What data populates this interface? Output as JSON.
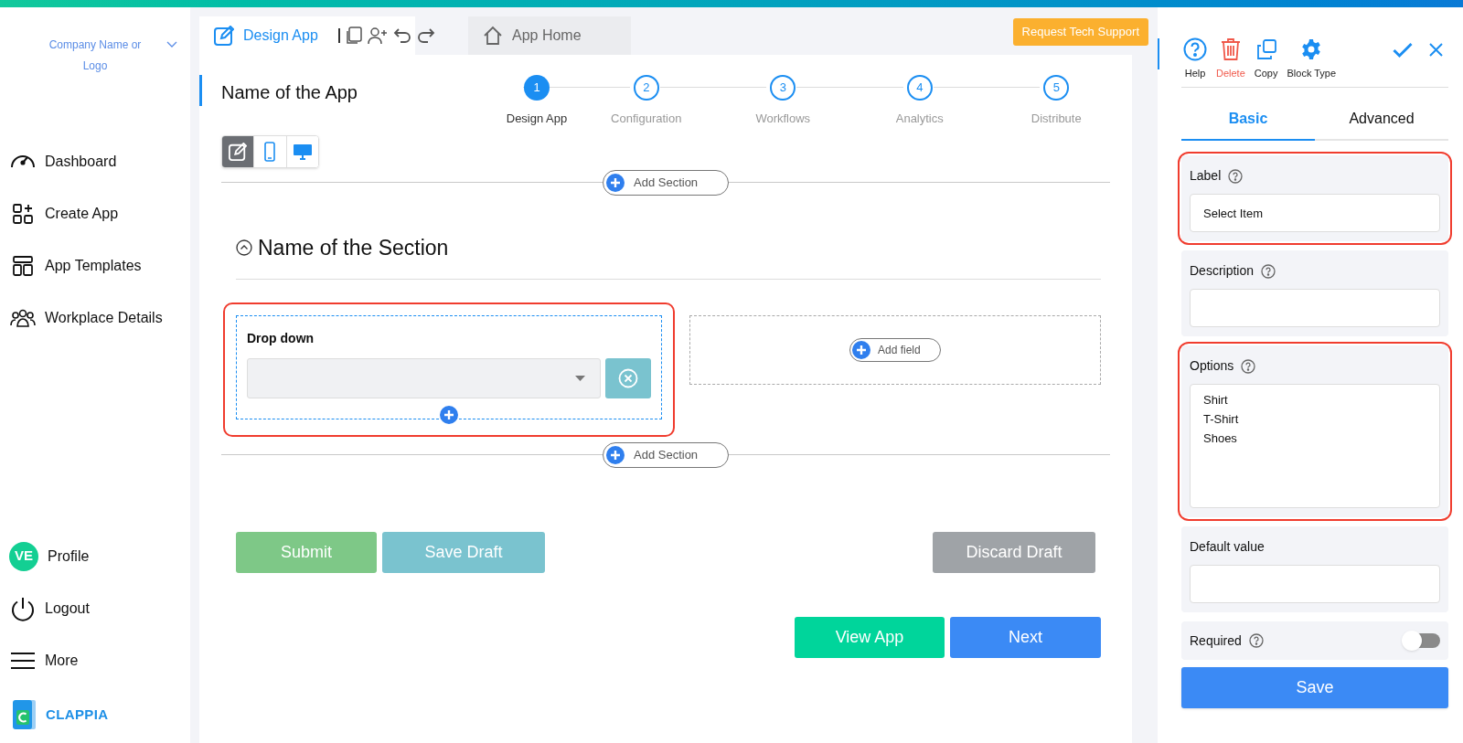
{
  "sidebar": {
    "company": "Company Name or Logo",
    "nav": [
      {
        "label": "Dashboard",
        "kind": "gauge"
      },
      {
        "label": "Create App",
        "kind": "create"
      },
      {
        "label": "App Templates",
        "kind": "templates"
      },
      {
        "label": "Workplace Details",
        "kind": "people"
      }
    ],
    "profile": {
      "initials": "VE",
      "label": "Profile"
    },
    "bottom": [
      {
        "label": "Logout",
        "kind": "power"
      },
      {
        "label": "More",
        "kind": "menu"
      }
    ],
    "brand": "CLAPPIA"
  },
  "topbar": {
    "tabs": [
      {
        "label": "Design App",
        "selected": true
      },
      {
        "label": "App Home",
        "selected": false
      }
    ],
    "support_button": "Request Tech Support"
  },
  "app_name": "Name of the App",
  "steps": [
    {
      "number": "1",
      "label": "Design App",
      "selected": true
    },
    {
      "number": "2",
      "label": "Configuration",
      "selected": false
    },
    {
      "number": "3",
      "label": "Workflows",
      "selected": false
    },
    {
      "number": "4",
      "label": "Analytics",
      "selected": false
    },
    {
      "number": "5",
      "label": "Distribute",
      "selected": false
    }
  ],
  "view_modes": [
    {
      "kind": "edit",
      "selected": true
    },
    {
      "kind": "mobile",
      "selected": false
    },
    {
      "kind": "desktop",
      "selected": false
    }
  ],
  "canvas": {
    "add_section_top": "Add Section",
    "section_title": "Name of the Section",
    "fields": [
      {
        "label": "Drop down",
        "highlighted": true
      }
    ],
    "add_field": "Add field",
    "add_section_bottom": "Add Section"
  },
  "form_buttons": [
    {
      "label": "Submit",
      "kind": "submit"
    },
    {
      "label": "Save Draft",
      "kind": "draft"
    },
    {
      "label": "Discard Draft",
      "kind": "discard"
    }
  ],
  "nav_buttons": [
    {
      "label": "View App",
      "kind": "view"
    },
    {
      "label": "Next",
      "kind": "next"
    }
  ],
  "panel": {
    "toolbar": [
      {
        "label": "Help",
        "kind": "help"
      },
      {
        "label": "Delete",
        "kind": "delete"
      },
      {
        "label": "Copy",
        "kind": "copy"
      },
      {
        "label": "Block Type",
        "kind": "type"
      }
    ],
    "tabs": [
      {
        "label": "Basic",
        "selected": true
      },
      {
        "label": "Advanced",
        "selected": false
      }
    ],
    "properties": [
      {
        "label": "Label",
        "kind": "text",
        "help": true,
        "highlighted": true,
        "value": "Select Item"
      },
      {
        "label": "Description",
        "kind": "text",
        "help": true,
        "highlighted": false
      },
      {
        "label": "Options",
        "kind": "options",
        "help": true,
        "highlighted": true,
        "lines": [
          "Shirt",
          "T-Shirt",
          "Shoes"
        ]
      },
      {
        "label": "Default value",
        "kind": "text",
        "help": false,
        "highlighted": false
      },
      {
        "label": "Required",
        "kind": "toggle",
        "help": true,
        "highlighted": false,
        "on": false
      }
    ],
    "save_button": "Save"
  }
}
